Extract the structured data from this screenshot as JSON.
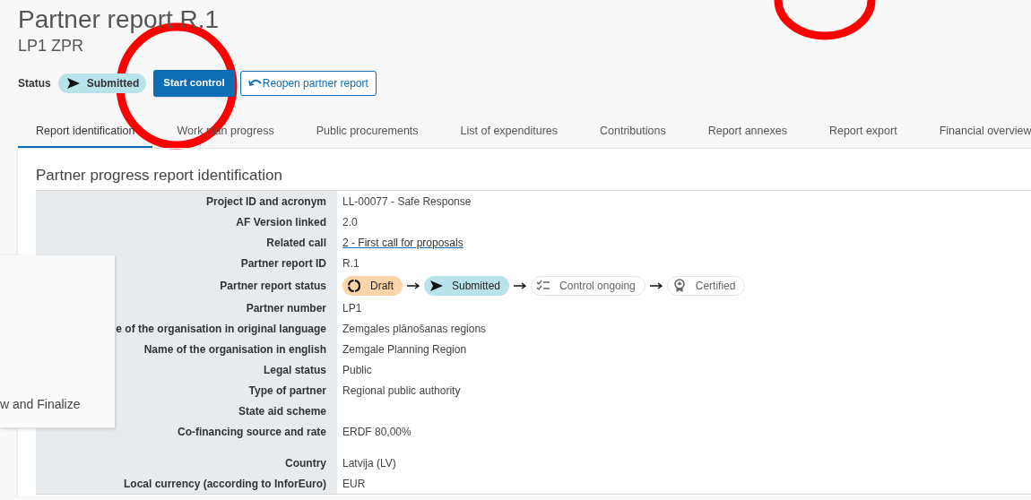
{
  "header": {
    "title": "Partner report R.1",
    "subtitle": "LP1 ZPR"
  },
  "status": {
    "label": "Status",
    "value": "Submitted",
    "color": "#b9e3ea"
  },
  "actions": [
    {
      "label": "Start control",
      "kind": "primary"
    },
    {
      "label": "Reopen partner report",
      "kind": "outline"
    }
  ],
  "tabs": [
    {
      "label": "Report identification",
      "selected": true
    },
    {
      "label": "Work plan progress",
      "selected": false
    },
    {
      "label": "Public procurements",
      "selected": false
    },
    {
      "label": "List of expenditures",
      "selected": false
    },
    {
      "label": "Contributions",
      "selected": false
    },
    {
      "label": "Report annexes",
      "selected": false
    },
    {
      "label": "Report export",
      "selected": false
    },
    {
      "label": "Financial overview",
      "selected": false
    }
  ],
  "section": {
    "title": "Partner progress report identification",
    "rows": [
      {
        "label": "Project ID and acronym",
        "kind": "text",
        "value": "LL-00077 - Safe Response"
      },
      {
        "label": "AF Version linked",
        "kind": "text",
        "value": "2.0"
      },
      {
        "label": "Related call",
        "kind": "link",
        "value": "2 - First call for proposals"
      },
      {
        "label": "Partner report ID",
        "kind": "text",
        "value": "R.1"
      },
      {
        "label": "Partner report status",
        "kind": "status",
        "statuses": [
          {
            "label": "Draft",
            "kind": "draft",
            "reached": true,
            "color": "#fdd3a8"
          },
          {
            "label": "Submitted",
            "kind": "submitted",
            "reached": true,
            "color": "#b9e3ea"
          },
          {
            "label": "Control ongoing",
            "kind": "control",
            "reached": false,
            "color": "#ffffff"
          },
          {
            "label": "Certified",
            "kind": "certified",
            "reached": false,
            "color": "#ffffff"
          }
        ]
      },
      {
        "label": "Partner number",
        "kind": "text",
        "value": "LP1"
      },
      {
        "label": "e of the organisation in original language",
        "kind": "text",
        "value": "Zemgales plānošanas regions"
      },
      {
        "label": "Name of the organisation in english",
        "kind": "text",
        "value": "Zemgale Planning Region"
      },
      {
        "label": "Legal status",
        "kind": "text",
        "value": "Public"
      },
      {
        "label": "Type of partner",
        "kind": "text",
        "value": "Regional public authority"
      },
      {
        "label": "State aid scheme",
        "kind": "text"
      },
      {
        "label": "Co-financing source and rate",
        "kind": "text",
        "value": "ERDF 80,00%"
      },
      {
        "label": "Country",
        "kind": "text",
        "value": "Latvija (LV)",
        "gap_before": true
      },
      {
        "label": "Local currency (according to InforEuro)",
        "kind": "text",
        "value": "EUR"
      }
    ]
  },
  "overlay_panel": {
    "text": "w and Finalize"
  },
  "annotations": [
    {
      "kind": "circle"
    },
    {
      "kind": "circle"
    }
  ]
}
